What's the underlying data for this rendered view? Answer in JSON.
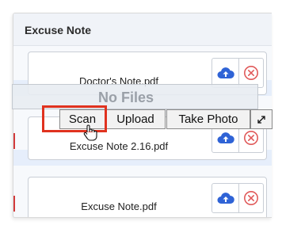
{
  "header": {
    "title": "Excuse Note"
  },
  "files": [
    {
      "name": "Doctor's Note.pdf",
      "upload_icon": "cloud-upload-icon",
      "delete_icon": "circle-x-icon"
    },
    {
      "name": "Excuse Note 2.16.pdf",
      "upload_icon": "cloud-upload-icon",
      "delete_icon": "circle-x-icon"
    },
    {
      "name": "Excuse Note.pdf",
      "upload_icon": "cloud-upload-icon",
      "delete_icon": "circle-x-icon"
    }
  ],
  "overlay": {
    "message": "No Files",
    "buttons": {
      "scan": "Scan",
      "upload": "Upload",
      "take_photo": "Take Photo"
    },
    "expand_icon": "expand-arrows-icon"
  },
  "colors": {
    "accent_blue": "#2f63d6",
    "delete_red": "#e05a5a",
    "highlight_red": "#e0321f"
  }
}
